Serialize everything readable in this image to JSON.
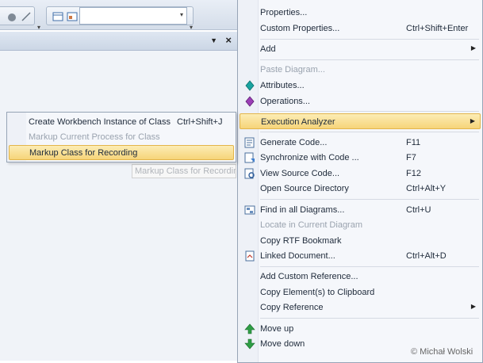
{
  "context_menu": {
    "items": [
      {
        "label": "Properties...",
        "shortcut": "",
        "disabled": false
      },
      {
        "label": "Custom Properties...",
        "shortcut": "Ctrl+Shift+Enter",
        "disabled": false
      },
      {
        "label": "Add",
        "shortcut": "",
        "disabled": false,
        "submenu": true
      },
      {
        "label": "Paste Diagram...",
        "shortcut": "",
        "disabled": true
      },
      {
        "label": "Attributes...",
        "shortcut": "",
        "disabled": false,
        "icon": "attributes-icon"
      },
      {
        "label": "Operations...",
        "shortcut": "",
        "disabled": false,
        "icon": "operations-icon"
      },
      {
        "label": "Execution Analyzer",
        "shortcut": "",
        "disabled": false,
        "submenu": true,
        "highlighted": true
      },
      {
        "label": "Generate Code...",
        "shortcut": "F11",
        "disabled": false,
        "icon": "generate-code-icon"
      },
      {
        "label": "Synchronize with Code ...",
        "shortcut": "F7",
        "disabled": false,
        "icon": "synchronize-code-icon"
      },
      {
        "label": "View Source Code...",
        "shortcut": "F12",
        "disabled": false,
        "icon": "view-source-icon"
      },
      {
        "label": "Open Source Directory",
        "shortcut": "Ctrl+Alt+Y",
        "disabled": false
      },
      {
        "label": "Find in all Diagrams...",
        "shortcut": "Ctrl+U",
        "disabled": false,
        "icon": "find-diagrams-icon"
      },
      {
        "label": "Locate in Current Diagram",
        "shortcut": "",
        "disabled": true
      },
      {
        "label": "Copy RTF Bookmark",
        "shortcut": "",
        "disabled": false
      },
      {
        "label": "Linked Document...",
        "shortcut": "Ctrl+Alt+D",
        "disabled": false,
        "icon": "linked-document-icon"
      },
      {
        "label": "Add Custom Reference...",
        "shortcut": "",
        "disabled": false
      },
      {
        "label": "Copy Element(s) to Clipboard",
        "shortcut": "",
        "disabled": false
      },
      {
        "label": "Copy Reference",
        "shortcut": "",
        "disabled": false,
        "submenu": true
      },
      {
        "label": "Move up",
        "shortcut": "",
        "disabled": false,
        "icon": "move-up-icon"
      },
      {
        "label": "Move down",
        "shortcut": "",
        "disabled": false,
        "icon": "move-down-icon"
      }
    ]
  },
  "submenu": {
    "items": [
      {
        "label": "Create Workbench Instance of Class",
        "shortcut": "Ctrl+Shift+J",
        "disabled": false
      },
      {
        "label": "Markup Current Process for Class",
        "shortcut": "",
        "disabled": true
      },
      {
        "label": "Markup Class for Recording",
        "shortcut": "",
        "disabled": false,
        "highlighted": true
      }
    ]
  },
  "ghost_tooltip": "Markup Class for Recording",
  "watermark": "© Michał Wolski",
  "colors": {
    "highlight_top": "#fcedb5",
    "highlight_bottom": "#f6d479",
    "highlight_border": "#e3b54a",
    "menu_bg": "#f5f7fb"
  }
}
